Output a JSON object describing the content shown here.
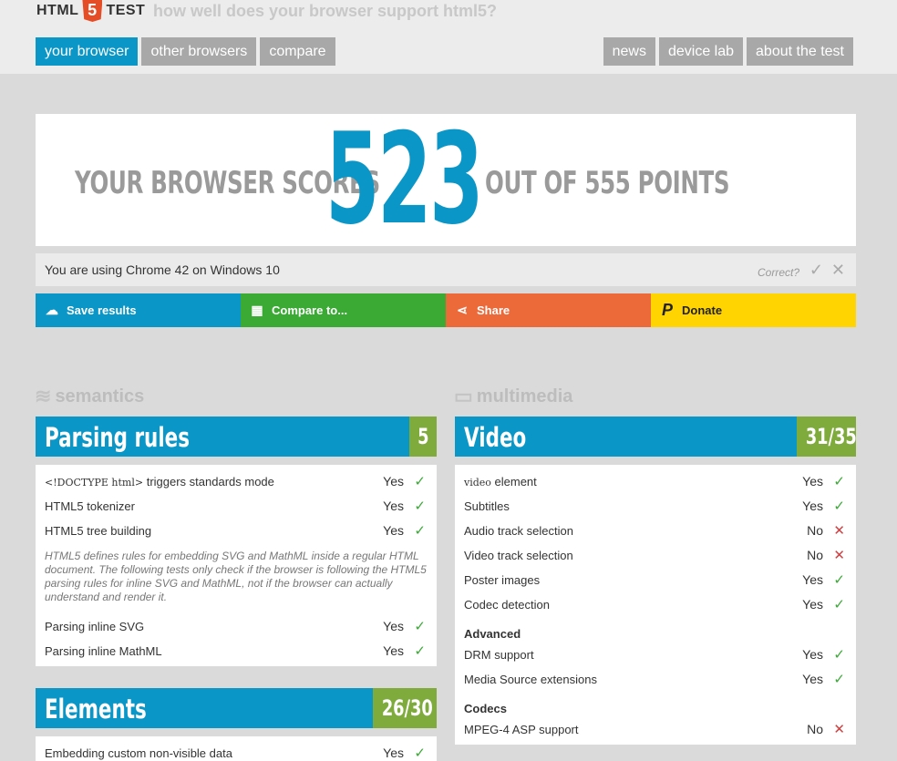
{
  "logo": {
    "left": "HTML",
    "mid": "5",
    "right": "TEST"
  },
  "tagline": "how well does your browser support html5?",
  "nav_left": [
    "your browser",
    "other browsers",
    "compare"
  ],
  "nav_right": [
    "news",
    "device lab",
    "about the test"
  ],
  "score": {
    "prefix": "YOUR BROWSER SCORES",
    "value": "523",
    "suffix": "OUT OF 555 POINTS"
  },
  "using": {
    "text": "You are using Chrome 42 on Windows 10",
    "correct": "Correct?",
    "yes_icon": "checkmark-icon",
    "no_icon": "close-icon"
  },
  "actions": {
    "save": {
      "label": "Save results",
      "icon": "cloud-upload-icon"
    },
    "compare": {
      "label": "Compare to...",
      "icon": "grid-icon"
    },
    "share": {
      "label": "Share",
      "icon": "share-icon"
    },
    "donate": {
      "label": "Donate",
      "icon": "paypal-icon"
    }
  },
  "categories": {
    "left": "semantics",
    "right": "multimedia"
  },
  "parsing": {
    "title": "Parsing rules",
    "points": "5",
    "rows": [
      {
        "code": "<!DOCTYPE html>",
        "label": " triggers standards mode",
        "result": "Yes"
      },
      {
        "label": "HTML5 tokenizer",
        "result": "Yes"
      },
      {
        "label": "HTML5 tree building",
        "result": "Yes"
      }
    ],
    "note": "HTML5 defines rules for embedding SVG and MathML inside a regular HTML document. The following tests only check if the browser is following the HTML5 parsing rules for inline SVG and MathML, not if the browser can actually understand and render it.",
    "rows2": [
      {
        "label": "Parsing inline SVG",
        "result": "Yes"
      },
      {
        "label": "Parsing inline MathML",
        "result": "Yes"
      }
    ]
  },
  "elements": {
    "title": "Elements",
    "points": "26/30",
    "rows": [
      {
        "label": "Embedding custom non-visible data",
        "result": "Yes"
      }
    ]
  },
  "video": {
    "title": "Video",
    "points": "31/35",
    "rows": [
      {
        "code": "video",
        "label": " element",
        "result": "Yes"
      },
      {
        "label": "Subtitles",
        "result": "Yes"
      },
      {
        "label": "Audio track selection",
        "result": "No"
      },
      {
        "label": "Video track selection",
        "result": "No"
      },
      {
        "label": "Poster images",
        "result": "Yes"
      },
      {
        "label": "Codec detection",
        "result": "Yes"
      }
    ],
    "advanced": "Advanced",
    "rows2": [
      {
        "label": "DRM support",
        "result": "Yes"
      },
      {
        "label": "Media Source extensions",
        "result": "Yes"
      }
    ],
    "codecs": "Codecs",
    "rows3": [
      {
        "label": "MPEG-4 ASP support",
        "result": "No"
      }
    ]
  },
  "colors": {
    "blue": "#0b96c8",
    "green": "#3aaa35",
    "orange": "#ec6a3a",
    "yellow": "#ffd400",
    "points_green": "#7faa3c"
  }
}
